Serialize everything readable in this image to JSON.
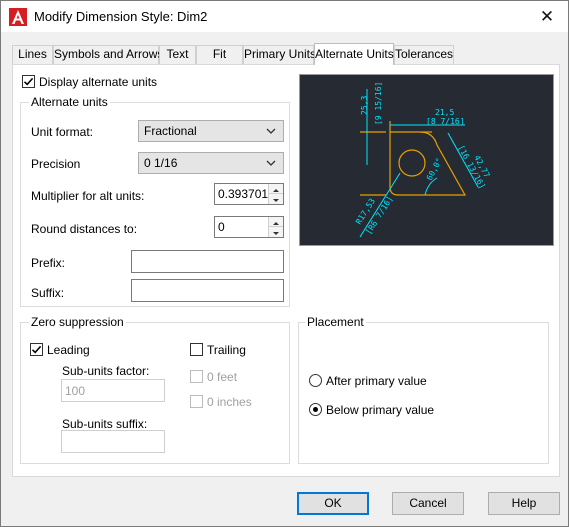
{
  "window": {
    "title": "Modify Dimension Style: Dim2",
    "app_icon": "autocad-a-icon",
    "close_icon": "close-icon"
  },
  "tabs": [
    {
      "label": "Lines",
      "active": false
    },
    {
      "label": "Symbols and Arrows",
      "active": false
    },
    {
      "label": "Text",
      "active": false
    },
    {
      "label": "Fit",
      "active": false
    },
    {
      "label": "Primary Units",
      "active": false
    },
    {
      "label": "Alternate Units",
      "active": true
    },
    {
      "label": "Tolerances",
      "active": false
    }
  ],
  "display_alternate": {
    "label": "Display alternate units",
    "checked": true
  },
  "alternate_units": {
    "title": "Alternate units",
    "unit_format_label": "Unit format:",
    "unit_format_value": "Fractional",
    "precision_label": "Precision",
    "precision_value": "0 1/16",
    "multiplier_label": "Multiplier for alt units:",
    "multiplier_value": "0.393701",
    "round_label": "Round distances  to:",
    "round_value": "0",
    "prefix_label": "Prefix:",
    "prefix_value": "",
    "suffix_label": "Suffix:",
    "suffix_value": ""
  },
  "zero_suppression": {
    "title": "Zero suppression",
    "leading_label": "Leading",
    "leading_checked": true,
    "trailing_label": "Trailing",
    "trailing_checked": false,
    "sub_units_factor_label": "Sub-units factor:",
    "sub_units_factor_value": "100",
    "sub_units_suffix_label": "Sub-units suffix:",
    "sub_units_suffix_value": "",
    "zero_feet_label": "0 feet",
    "zero_inches_label": "0 inches"
  },
  "placement": {
    "title": "Placement",
    "after_label": "After primary value",
    "below_label": "Below primary value",
    "selected": "below"
  },
  "preview": {
    "dims": {
      "top_width": "21,5",
      "top_width_alt": "[8 7/16]",
      "left_height": "25,3",
      "left_height_alt": "[9 15/16]",
      "right_diag": "42,77",
      "right_diag_alt": "[16 13/16]",
      "radius": "R17,53",
      "radius_alt": "[R6 7/16]",
      "angle": "60,0°"
    },
    "colors": {
      "background": "#252a33",
      "dimension": "#00e5ff",
      "geometry": "#e8a000"
    }
  },
  "buttons": {
    "ok": "OK",
    "cancel": "Cancel",
    "help": "Help"
  }
}
